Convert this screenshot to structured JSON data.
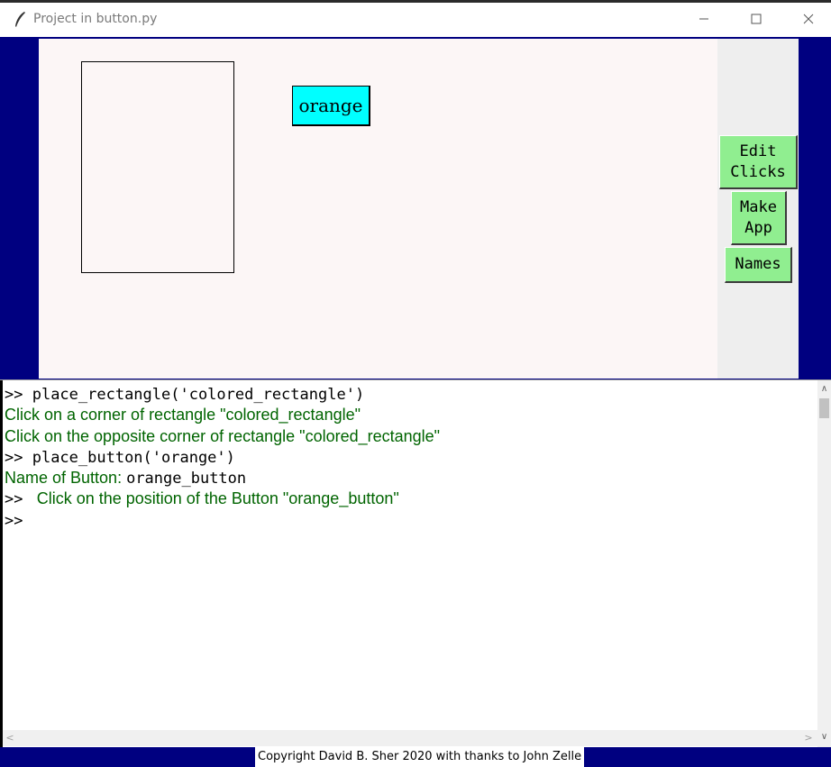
{
  "window": {
    "title": "Project in button.py",
    "controls": {
      "minimize_icon": "minimize-icon",
      "maximize_icon": "maximize-icon",
      "close_icon": "close-icon"
    }
  },
  "canvas": {
    "background": "#fcf6f6",
    "frame_color": "#000080",
    "orange_button_label": "orange",
    "orange_button_color": "#00ffff"
  },
  "side_panel": {
    "edit_clicks_label": "Edit\nClicks",
    "make_app_label": "Make\nApp",
    "names_label": "Names",
    "button_color": "#90ee90"
  },
  "console": {
    "lines": [
      {
        "prefix": ">> ",
        "text": "place_rectangle('colored_rectangle')"
      },
      {
        "text": "Click on a corner of rectangle \"colored_rectangle\""
      },
      {
        "text": "Click on the opposite corner of rectangle \"colored_rectangle\""
      },
      {
        "prefix": ">> ",
        "text": "place_button('orange')"
      },
      {
        "label": "Name of Button: ",
        "value": "orange_button"
      },
      {
        "prefix": ">> ",
        "text": " Click on the position of the Button \"orange_button\""
      },
      {
        "prefix": ">>"
      }
    ]
  },
  "footer": {
    "copyright": "Copyright David B. Sher 2020 with thanks to John Zelle"
  }
}
